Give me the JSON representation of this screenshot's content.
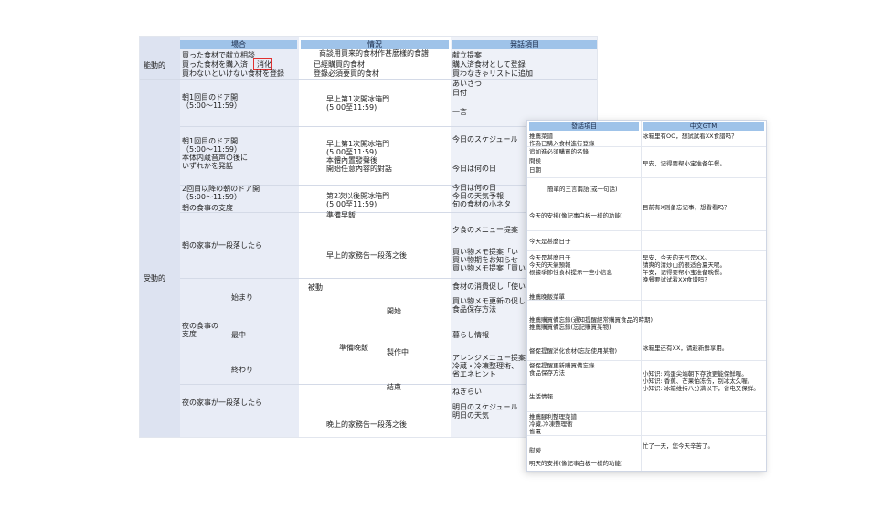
{
  "sheet1": {
    "headers": {
      "scene": "場合",
      "situation": "情況",
      "utterance": "発話項目"
    },
    "category": {
      "active": "能動的",
      "passive": "受動的"
    },
    "scene": {
      "r1": "買った食材で献立相談",
      "r2": "買った食材を購入済",
      "r2b": "消化",
      "r3": "買わないといけない食材を登録",
      "r4": "朝1回目のドア開\n（5:00～11:59）",
      "r5": "朝1回目のドア開\n（5:00～11:59）\n本体内蔵音声の後に\nいずれかを発話",
      "r6": "2回目以降の朝のドア開\n（5:00～11:59）",
      "r7": "朝の食事の支度",
      "r8": "朝の家事が一段落したら",
      "r9": "夜の食事の\n支度",
      "r9a": "始まり",
      "r9b": "最中",
      "r9c": "終わり",
      "r10": "夜の家事が一段落したら"
    },
    "situation": {
      "r1": "商談用買来的食材作甚麼樣的食譜",
      "r2": "已經購買的食材",
      "r3": "登錄必須要買的食材",
      "r4": "早上第1次開冰箱門\n(5:00至11:59)",
      "r5": "早上第1次開冰箱門\n(5:00至11:59)\n本體內置發聲後\n開始任意內容的對話",
      "r6": "第2次以後開冰箱門\n(5:00至11:59)",
      "r7": "準備早飯",
      "r8": "早上的家務告一段落之後",
      "passive": "被動",
      "r9": "準備晚飯",
      "r9a": "開始",
      "r9b": "製作中",
      "r9c": "結束",
      "r10": "晚上的家務告一段落之後"
    },
    "utterance": {
      "u1": "献立提案",
      "u2": "購入済食材として登録",
      "u3": "買わなきゃリストに追加",
      "u4": "あいさつ",
      "u5": "日付",
      "u6": "一言",
      "u7": "今日のスケジュール",
      "u8": "今日は何の日",
      "u9": "今日は何の日\n今日の天気予報\n旬の食材の小ネタ",
      "u10": "夕食のメニュー提案",
      "u11": "買い物メモ提案「い\n買い物期をお知らせ\n買い物メモ提案「買い",
      "u12": "食材の消費促し「使い",
      "u13": "買い物メモ更新の促し\n食品保存方法",
      "u14": "暮らし情報",
      "u15": "アレンジメニュー提案\n冷蔵・冷凍整理術、\n省エネヒント",
      "u16": "ねぎらい",
      "u17": "明日のスケジュール\n明日の天気"
    }
  },
  "sheet2": {
    "headers": {
      "utterance": "發話項目",
      "chinese": "中文GTM"
    },
    "rows": [
      "推薦菜譜",
      "作為已購入食材進行登錄",
      "追加進必須購買的名錄",
      "問候",
      "日期",
      "簡單的三言兩語(或一句話)",
      "今天的安排(像記事白板一樣的功能)",
      "今天是甚麼日子",
      "今天是甚麼日子\n今天的天氣預報\n根據季節性食材提示一些小信息",
      "推薦晚飯菜單",
      "推薦購買備忘錄(通知提醒經常購買食品的時期)\n推薦購買備忘錄(忘記購買某物)",
      "督促提醒消化食材(忘記使用某物)",
      "督促提醒更新購買備忘錄\n食品保存方法",
      "生活情報",
      "推薦腳利整理菜譜\n冷藏,冷凍整理術\n省電",
      "慰勞",
      "明天的安排(像記事白板一樣的功能)"
    ],
    "gtm": {
      "g1": "冰箱里有OO，想試試看XX食譜吗？",
      "g2": "早安，记得要帮小宝准备午餐。",
      "g3": "目前有X则备忘记事，想看看吗？",
      "g4": "早安，今天的天气是XX。\n請爽的清炒山药很适合夏天呢。\n午安，记得要帮小宝准备晚餐。\n晚餐要试试看XX食谱吗？",
      "g5": "冰箱里还有XX，请趁新鲜享用。",
      "g6": "小知识: 鸡蛋尖端朝下存放更能保鲜喔。\n小知识: 香蕉、芒果怕冻伤，别冰太久喔。\n小知识: 冰箱维持八分满以下，省电又保鲜。",
      "g7": "忙了一天，您今天辛苦了。"
    }
  }
}
